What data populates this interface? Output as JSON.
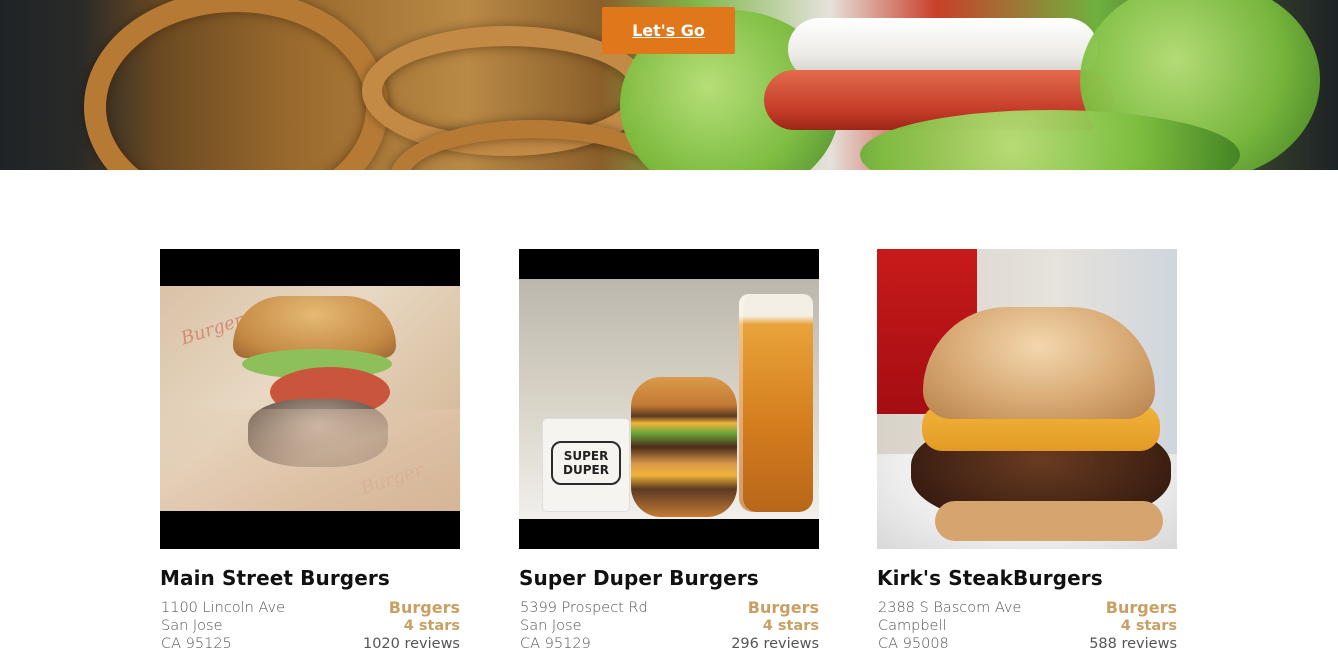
{
  "hero": {
    "cta_label": "Let's Go"
  },
  "restaurants": [
    {
      "name": "Main Street Burgers",
      "address_line1": "1100 Lincoln Ave",
      "address_line2": "San Jose",
      "address_line3": "CA 95125",
      "category": "Burgers",
      "rating": "4 stars",
      "reviews": "1020 reviews"
    },
    {
      "name": "Super Duper Burgers",
      "address_line1": "5399 Prospect Rd",
      "address_line2": "San Jose",
      "address_line3": "CA 95129",
      "category": "Burgers",
      "rating": "4 stars",
      "reviews": "296 reviews",
      "photo_text": "SUPER DUPER"
    },
    {
      "name": "Kirk's SteakBurgers",
      "address_line1": "2388 S Bascom Ave",
      "address_line2": "Campbell",
      "address_line3": "CA 95008",
      "category": "Burgers",
      "rating": "4 stars",
      "reviews": "588 reviews"
    }
  ],
  "colors": {
    "cta_background": "#e0781b",
    "accent_gold": "#c9a064",
    "text_dark": "#111111",
    "text_muted": "#555555"
  }
}
